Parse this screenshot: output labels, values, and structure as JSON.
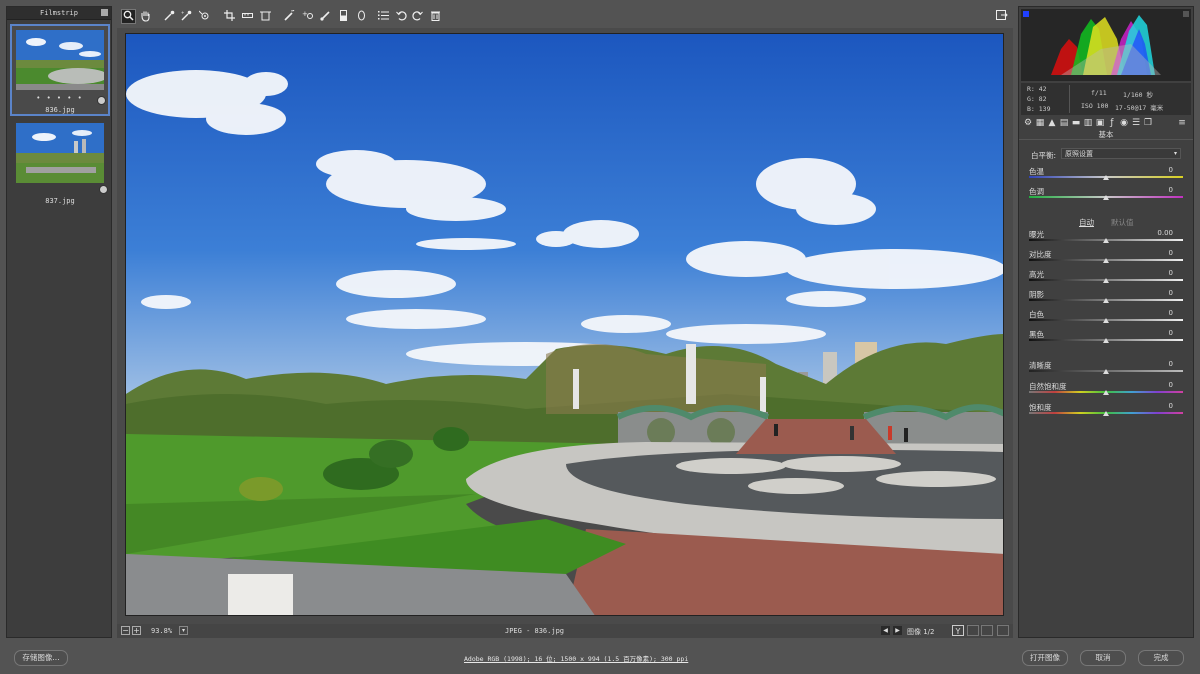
{
  "filmstrip": {
    "title": "Filmstrip",
    "items": [
      {
        "name": "836.jpg",
        "rating": "• • • • •",
        "selected": true
      },
      {
        "name": "837.jpg",
        "rating": "",
        "selected": false
      }
    ]
  },
  "toolbar": {
    "tools": [
      {
        "name": "zoom-icon",
        "glyph": "🔍"
      },
      {
        "name": "hand-icon",
        "glyph": "✋"
      },
      {
        "name": "white-balance-icon",
        "glyph": "⌁"
      },
      {
        "name": "color-sampler-icon",
        "glyph": "⌁"
      },
      {
        "name": "target-adjust-icon",
        "glyph": "◎"
      },
      {
        "name": "crop-icon",
        "glyph": "⌗"
      },
      {
        "name": "straighten-icon",
        "glyph": "▭"
      },
      {
        "name": "transform-icon",
        "glyph": "⌑"
      },
      {
        "name": "spot-removal-icon",
        "glyph": "✎"
      },
      {
        "name": "red-eye-icon",
        "glyph": "⊕"
      },
      {
        "name": "adjustment-brush-icon",
        "glyph": "✐"
      },
      {
        "name": "graduated-filter-icon",
        "glyph": "▮"
      },
      {
        "name": "radial-filter-icon",
        "glyph": "◯"
      },
      {
        "name": "preferences-icon",
        "glyph": "☰"
      },
      {
        "name": "rotate-left-icon",
        "glyph": "↺"
      },
      {
        "name": "rotate-right-icon",
        "glyph": "↻"
      },
      {
        "name": "trash-icon",
        "glyph": "🗑"
      }
    ],
    "fullscreen_icon": "⇱"
  },
  "status": {
    "zoom": "93.8%",
    "filename": "JPEG - 836.jpg",
    "image_counter": "图像 1/2",
    "y_label": "Y"
  },
  "info": {
    "r_label": "R:",
    "r_value": "42",
    "g_label": "G:",
    "g_value": "82",
    "b_label": "B:",
    "b_value": "139",
    "aperture": "f/11",
    "shutter": "1/160 秒",
    "iso": "ISO 100",
    "lens": "17-50@17 毫米"
  },
  "panel": {
    "section_title": "基本",
    "white_balance_label": "白平衡:",
    "white_balance_value": "原照设置",
    "auto_label": "自动",
    "default_label": "默认值",
    "sliders_wb": [
      {
        "label": "色温",
        "value": "0",
        "level": 0.5,
        "track": "temp"
      },
      {
        "label": "色调",
        "value": "0",
        "level": 0.5,
        "track": "tint"
      }
    ],
    "sliders_tone": [
      {
        "label": "曝光",
        "value": "0.00",
        "level": 0.5
      },
      {
        "label": "对比度",
        "value": "0",
        "level": 0.5
      },
      {
        "label": "高光",
        "value": "0",
        "level": 0.5
      },
      {
        "label": "阴影",
        "value": "0",
        "level": 0.5
      },
      {
        "label": "白色",
        "value": "0",
        "level": 0.5
      },
      {
        "label": "黑色",
        "value": "0",
        "level": 0.5
      }
    ],
    "sliders_presence": [
      {
        "label": "清晰度",
        "value": "0",
        "level": 0.5,
        "track": "gray"
      },
      {
        "label": "自然饱和度",
        "value": "0",
        "level": 0.5,
        "track": "sat"
      },
      {
        "label": "饱和度",
        "value": "0",
        "level": 0.5,
        "track": "sat"
      }
    ]
  },
  "footer": {
    "save_label": "存储图像...",
    "workflow_link": "Adobe RGB (1998); 16 位; 1500 x 994 (1.5 百万像素); 300 ppi",
    "open_label": "打开图像",
    "cancel_label": "取消",
    "done_label": "完成"
  }
}
